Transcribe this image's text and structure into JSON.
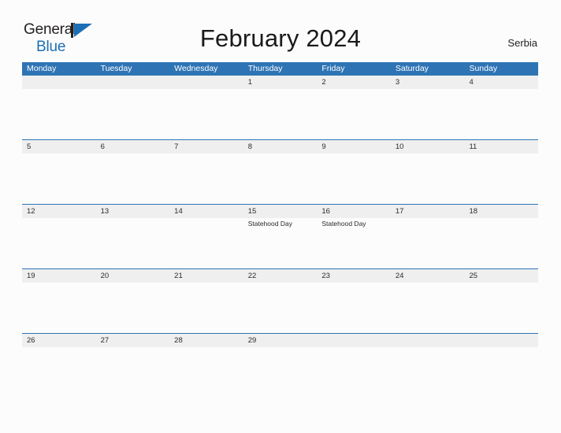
{
  "brand": {
    "name_part_1": "General",
    "name_part_2": "Blue",
    "accent_color": "#1c6fb5",
    "dark_color": "#231f20"
  },
  "header": {
    "title": "February 2024",
    "region": "Serbia"
  },
  "theme": {
    "header_row_bg": "#2e74b5",
    "date_band_bg": "#efefef",
    "page_bg": "#fcfcfc",
    "text_color": "#2b2b2b"
  },
  "calendar": {
    "weekdays": [
      "Monday",
      "Tuesday",
      "Wednesday",
      "Thursday",
      "Friday",
      "Saturday",
      "Sunday"
    ],
    "weeks": [
      {
        "days": [
          {
            "date": "",
            "events": []
          },
          {
            "date": "",
            "events": []
          },
          {
            "date": "",
            "events": []
          },
          {
            "date": "1",
            "events": []
          },
          {
            "date": "2",
            "events": []
          },
          {
            "date": "3",
            "events": []
          },
          {
            "date": "4",
            "events": []
          }
        ]
      },
      {
        "days": [
          {
            "date": "5",
            "events": []
          },
          {
            "date": "6",
            "events": []
          },
          {
            "date": "7",
            "events": []
          },
          {
            "date": "8",
            "events": []
          },
          {
            "date": "9",
            "events": []
          },
          {
            "date": "10",
            "events": []
          },
          {
            "date": "11",
            "events": []
          }
        ]
      },
      {
        "days": [
          {
            "date": "12",
            "events": []
          },
          {
            "date": "13",
            "events": []
          },
          {
            "date": "14",
            "events": []
          },
          {
            "date": "15",
            "events": [
              "Statehood Day"
            ]
          },
          {
            "date": "16",
            "events": [
              "Statehood Day"
            ]
          },
          {
            "date": "17",
            "events": []
          },
          {
            "date": "18",
            "events": []
          }
        ]
      },
      {
        "days": [
          {
            "date": "19",
            "events": []
          },
          {
            "date": "20",
            "events": []
          },
          {
            "date": "21",
            "events": []
          },
          {
            "date": "22",
            "events": []
          },
          {
            "date": "23",
            "events": []
          },
          {
            "date": "24",
            "events": []
          },
          {
            "date": "25",
            "events": []
          }
        ]
      },
      {
        "days": [
          {
            "date": "26",
            "events": []
          },
          {
            "date": "27",
            "events": []
          },
          {
            "date": "28",
            "events": []
          },
          {
            "date": "29",
            "events": []
          },
          {
            "date": "",
            "events": []
          },
          {
            "date": "",
            "events": []
          },
          {
            "date": "",
            "events": []
          }
        ]
      }
    ]
  }
}
